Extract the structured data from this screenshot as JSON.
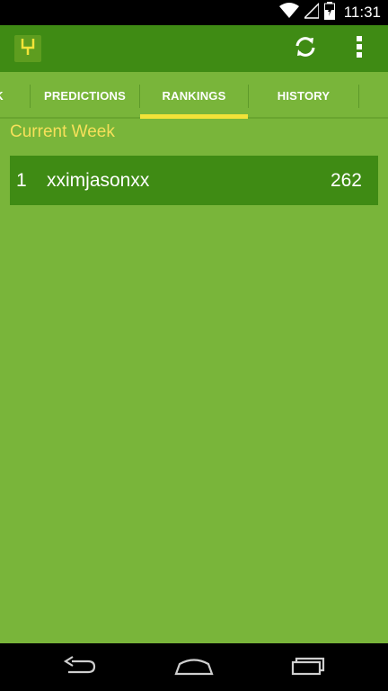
{
  "status_bar": {
    "time": "11:31",
    "icons": [
      "wifi-icon",
      "cell-signal-icon",
      "battery-icon"
    ]
  },
  "action_bar": {
    "logo_icon": "goalpost-icon",
    "actions": [
      "refresh-icon",
      "overflow-menu-icon"
    ],
    "colors": {
      "bar": "#3f8b14",
      "logo": "#5e9d1f",
      "logo_glyph": "#f2e338"
    }
  },
  "tabs": [
    {
      "label": "K"
    },
    {
      "label": "PREDICTIONS"
    },
    {
      "label": "RANKINGS",
      "selected": true
    },
    {
      "label": "HISTORY"
    }
  ],
  "section": {
    "title": "Current Week"
  },
  "rankings": [
    {
      "rank": "1",
      "name": "xximjasonxx",
      "score": "262"
    }
  ],
  "colors": {
    "background": "#79b53a",
    "row": "#3f8b14",
    "accent": "#f2e338",
    "section_title": "#f6e05a"
  },
  "nav_bar": {
    "buttons": [
      "back-icon",
      "home-icon",
      "recent-apps-icon"
    ]
  }
}
